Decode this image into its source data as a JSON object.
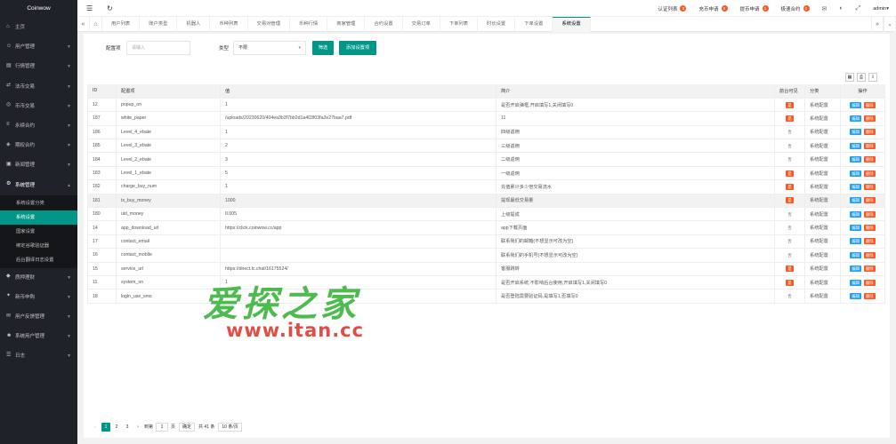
{
  "app": {
    "brand": "Coinwow"
  },
  "sidebar": {
    "items": [
      {
        "label": "主页",
        "icon": "home-icon",
        "has_arrow": false
      },
      {
        "label": "用户管理",
        "icon": "user-icon",
        "has_arrow": true
      },
      {
        "label": "行情管理",
        "icon": "chart-icon",
        "has_arrow": true
      },
      {
        "label": "法币交易",
        "icon": "exchange-icon",
        "has_arrow": true
      },
      {
        "label": "币币交易",
        "icon": "coin-icon",
        "has_arrow": true
      },
      {
        "label": "永续合约",
        "icon": "contract-icon",
        "has_arrow": true
      },
      {
        "label": "期权合约",
        "icon": "option-icon",
        "has_arrow": true
      },
      {
        "label": "新闻管理",
        "icon": "news-icon",
        "has_arrow": true
      },
      {
        "label": "系统管理",
        "icon": "gear-icon",
        "has_arrow": true,
        "open": true
      }
    ],
    "submenu": [
      {
        "label": "系统设置分类",
        "active": false
      },
      {
        "label": "系统设置",
        "active": true
      },
      {
        "label": "国家设置",
        "active": false
      },
      {
        "label": "绑定谷歌验证器",
        "active": false
      },
      {
        "label": "后台翻译日志设置",
        "active": false
      }
    ],
    "items_after": [
      {
        "label": "质押理财",
        "icon": "finance-icon"
      },
      {
        "label": "新币申购",
        "icon": "ico-icon"
      },
      {
        "label": "用户反馈管理",
        "icon": "feedback-icon"
      },
      {
        "label": "系统用户管理",
        "icon": "admin-icon"
      },
      {
        "label": "日志",
        "icon": "log-icon"
      }
    ]
  },
  "topbar": {
    "links": [
      {
        "label": "认证列表",
        "badge": "0"
      },
      {
        "label": "充币申请",
        "badge": "0"
      },
      {
        "label": "提币申请",
        "badge": "1"
      },
      {
        "label": "极速合约",
        "badge": "0"
      }
    ],
    "user": "admin"
  },
  "tabs": [
    "用户列表",
    "账户类型",
    "机器人",
    "币种列表",
    "交易对管理",
    "币种行情",
    "商家管理",
    "合约设置",
    "交易订单",
    "下单列表",
    "时长设置",
    "下单设置",
    "系统设置"
  ],
  "active_tab": 12,
  "filter": {
    "key_label": "配置项",
    "key_placeholder": "请输入",
    "type_label": "类型",
    "type_value": "不限",
    "search_btn": "筛选",
    "add_btn": "添加设置项"
  },
  "table": {
    "headers": [
      "ID",
      "配置项",
      "值",
      "简介",
      "前台可见",
      "分类",
      "操作"
    ],
    "edit_label": "编辑",
    "delete_label": "删除",
    "visible_yes": "是",
    "visible_no": "否",
    "rows": [
      {
        "id": "12",
        "key": "popup_on",
        "value": "1",
        "desc": "是否开启弹框,开启填写1,关闭填写0",
        "visible": true,
        "category": "系统配置"
      },
      {
        "id": "187",
        "key": "white_paper",
        "value": "/uploads/20230620/404ea3b3f7bb2d1a403f03fa2e27baa7.pdf",
        "desc": "11",
        "visible": true,
        "category": "系统配置"
      },
      {
        "id": "186",
        "key": "Level_4_ebate",
        "value": "1",
        "desc": "四级返佣",
        "visible": false,
        "category": "系统配置"
      },
      {
        "id": "185",
        "key": "Level_3_ebate",
        "value": "2",
        "desc": "三级返佣",
        "visible": false,
        "category": "系统配置"
      },
      {
        "id": "184",
        "key": "Level_2_ebate",
        "value": "3",
        "desc": "二级返佣",
        "visible": false,
        "category": "系统配置"
      },
      {
        "id": "183",
        "key": "Level_1_ebate",
        "value": "5",
        "desc": "一级返佣",
        "visible": true,
        "category": "系统配置"
      },
      {
        "id": "182",
        "key": "charge_buy_num",
        "value": "1",
        "desc": "充值累计多少倍交易流水",
        "visible": true,
        "category": "系统配置"
      },
      {
        "id": "181",
        "key": "tx_buy_money",
        "value": "1000",
        "desc": "提现最低交易量",
        "visible": true,
        "category": "系统配置",
        "highlight": true
      },
      {
        "id": "180",
        "key": "uid_money",
        "value": "0.005",
        "desc": "上级提成",
        "visible": false,
        "category": "系统配置"
      },
      {
        "id": "14",
        "key": "app_download_url",
        "value": "https://click.coinwow.cc/app",
        "desc": "app下载页面",
        "visible": false,
        "category": "系统配置"
      },
      {
        "id": "17",
        "key": "contact_email",
        "value": "",
        "desc": "联系我们的邮箱(不想显示可改为空)",
        "visible": false,
        "category": "系统配置"
      },
      {
        "id": "16",
        "key": "contact_mobile",
        "value": "",
        "desc": "联系我们的手机号(不想显示可改为空)",
        "visible": false,
        "category": "系统配置"
      },
      {
        "id": "15",
        "key": "service_url",
        "value": "https://direct.lc.chat/16175524/",
        "desc": "客服跳转",
        "visible": true,
        "category": "系统配置"
      },
      {
        "id": "11",
        "key": "system_on",
        "value": "1",
        "desc": "是否开启系统,不影响后台使用,开启填写1,关闭填写0",
        "visible": true,
        "category": "系统配置"
      },
      {
        "id": "18",
        "key": "login_use_sms",
        "value": "0",
        "desc": "是否登陆需要验证码,是填写1,否填写0",
        "visible": false,
        "category": "系统配置"
      }
    ]
  },
  "pager": {
    "pages": [
      "1",
      "2",
      "3"
    ],
    "current": "1",
    "goto_prefix": "到第",
    "goto_value": "1",
    "goto_suffix": "页",
    "confirm": "确定",
    "total": "共 41 条",
    "page_size": "10 条/页"
  },
  "watermark": {
    "title": "爱探之家",
    "url": "www.itan.cc"
  }
}
